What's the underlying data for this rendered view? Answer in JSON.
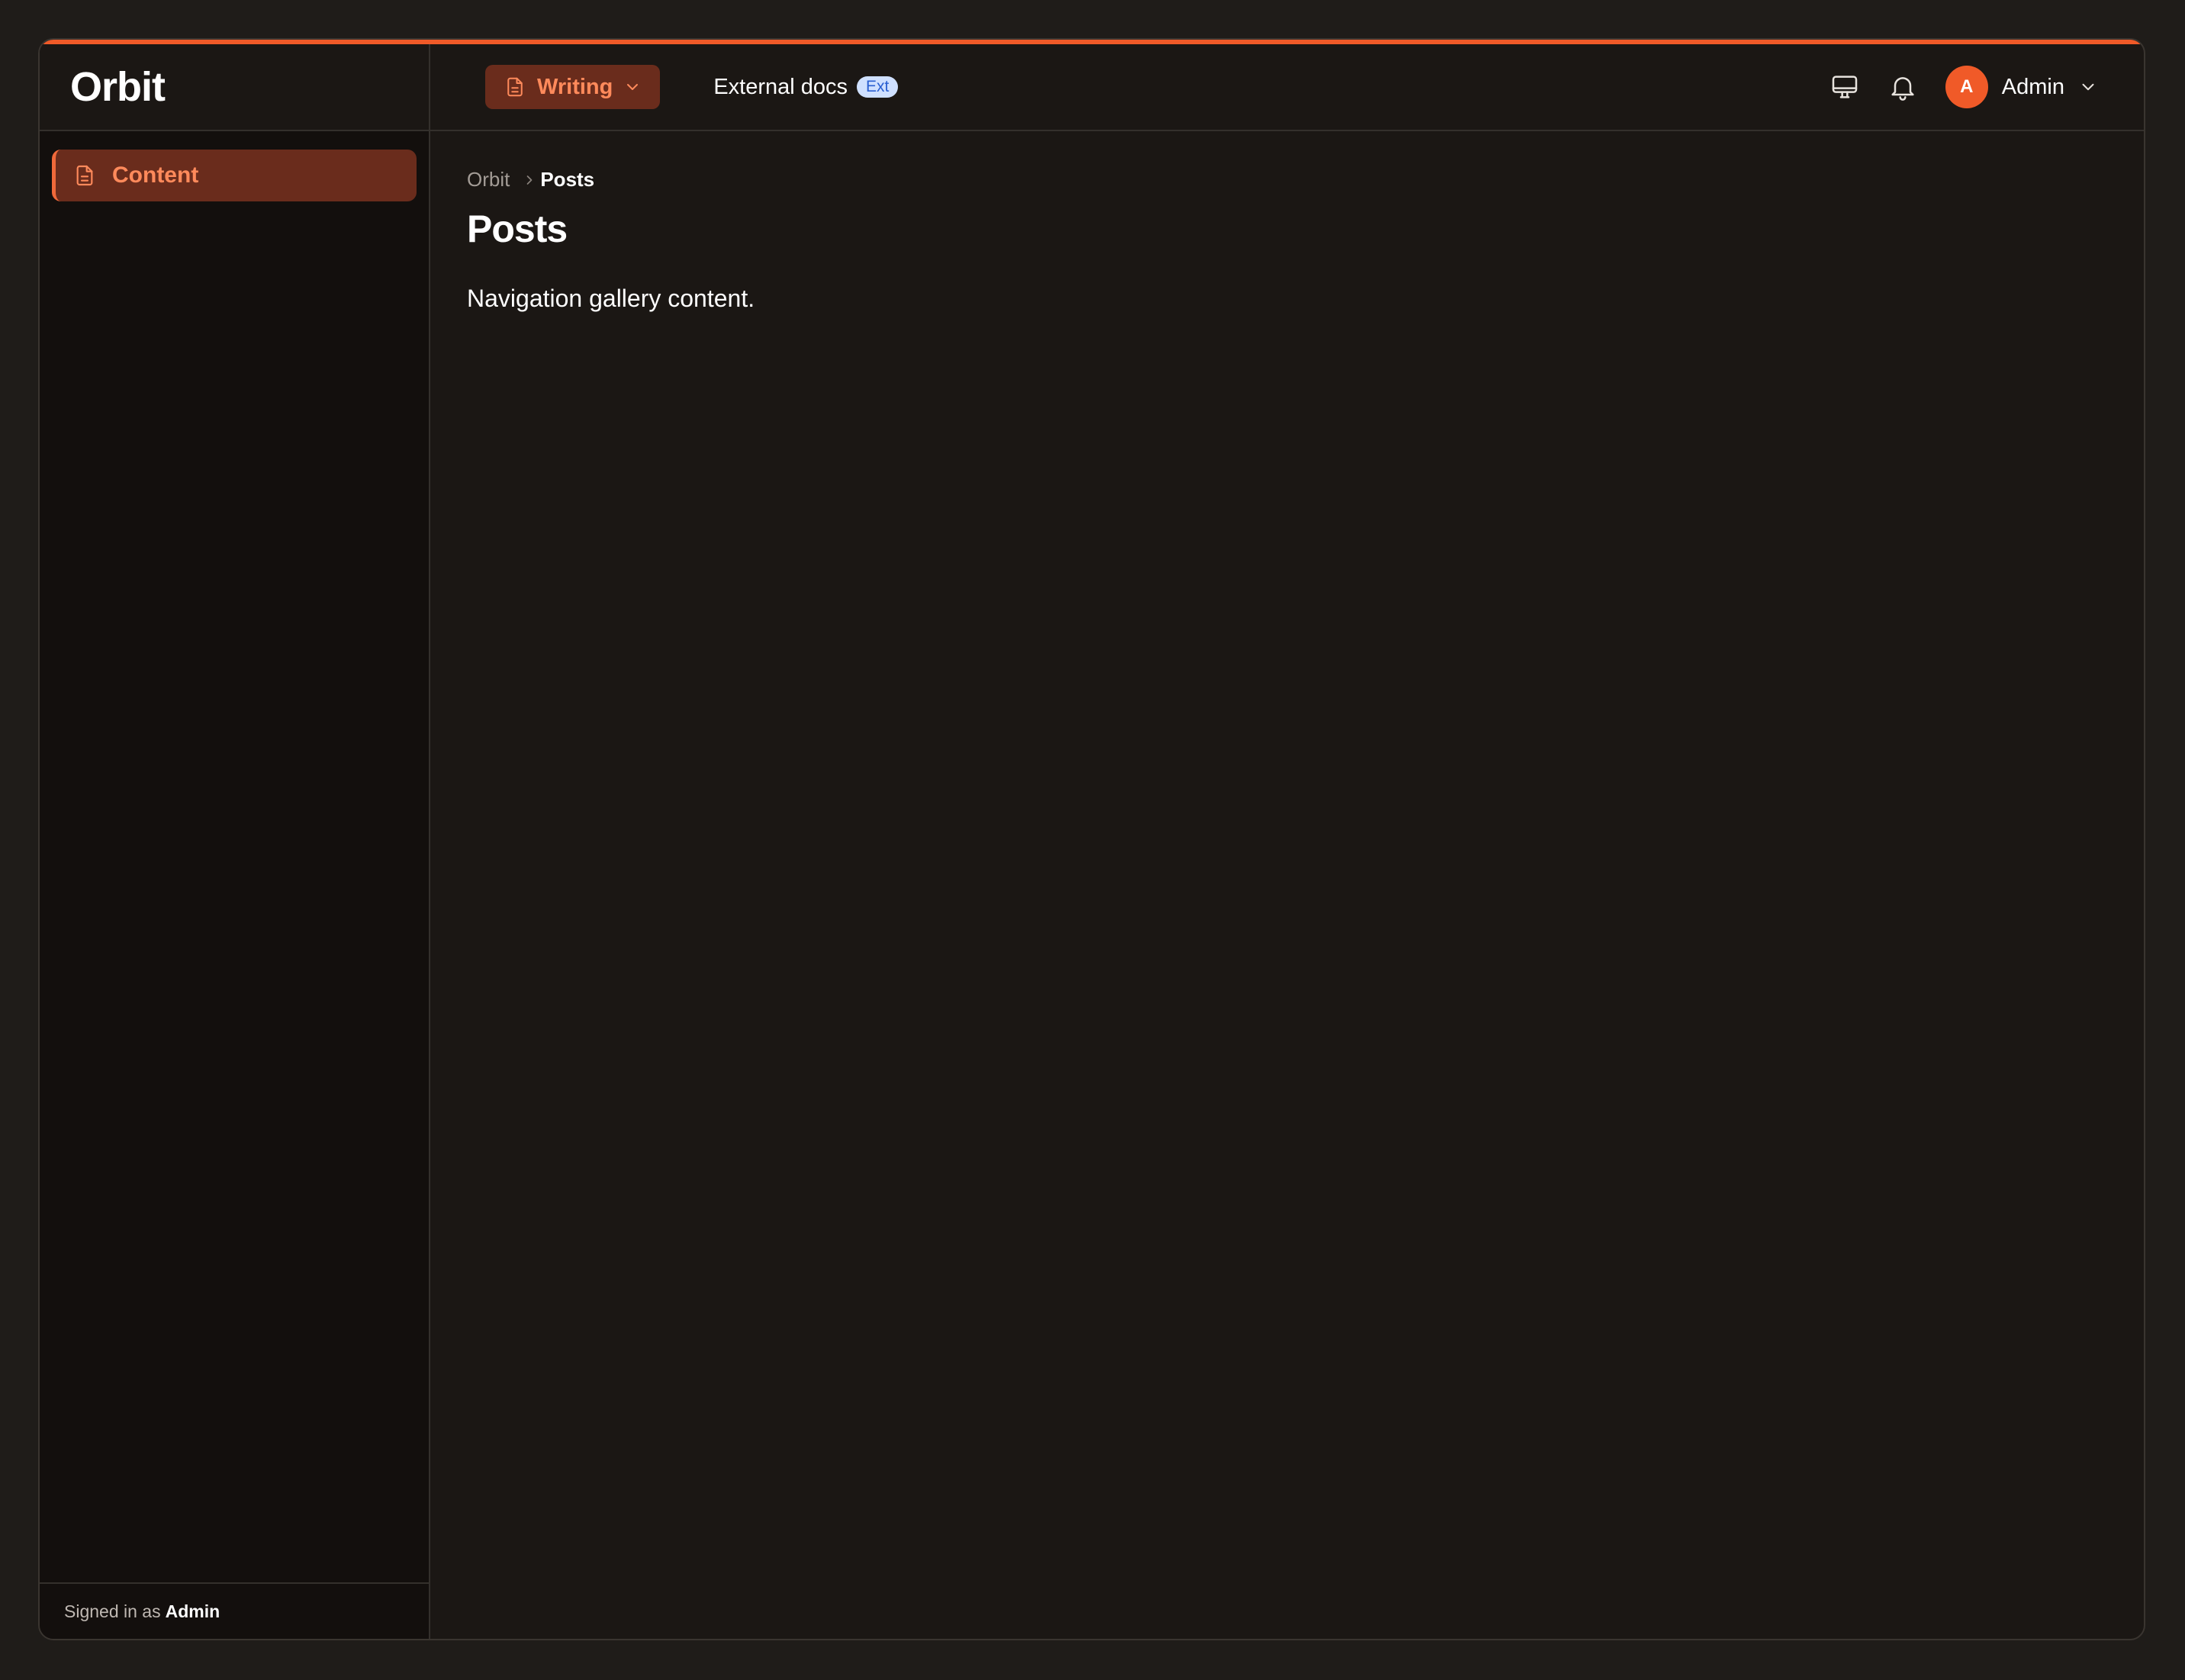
{
  "app": {
    "brand": "Orbit",
    "accent": "#f05a28"
  },
  "sidebar": {
    "items": [
      {
        "label": "Content",
        "icon": "document-icon",
        "active": true
      }
    ],
    "footer": {
      "prefix": "Signed in as",
      "user": "Admin"
    }
  },
  "topbar": {
    "workspace_button": {
      "label": "Writing",
      "icon": "document-icon"
    },
    "external_link": {
      "label": "External docs",
      "badge": "Ext"
    },
    "icons": [
      "monitor-icon",
      "bell-icon"
    ],
    "user": {
      "avatar_initial": "A",
      "name": "Admin"
    }
  },
  "main": {
    "breadcrumb": {
      "root": "Orbit",
      "current": "Posts"
    },
    "title": "Posts",
    "body": "Navigation gallery content."
  }
}
